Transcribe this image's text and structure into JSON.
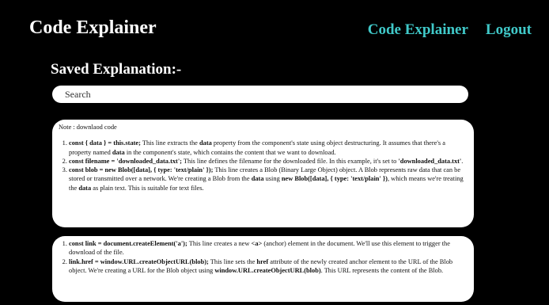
{
  "header": {
    "brand": "Code Explainer",
    "nav": {
      "explainer": "Code Explainer",
      "logout": "Logout"
    }
  },
  "main": {
    "section_title": "Saved Explanation:-",
    "search": {
      "placeholder": "Search",
      "value": ""
    },
    "cards": [
      {
        "note": "Note : downlaod code",
        "items": [
          [
            {
              "t": "const { data } = this.state;",
              "b": true
            },
            {
              "t": " This line extracts the ",
              "b": false
            },
            {
              "t": "data",
              "b": true
            },
            {
              "t": " property from the component's state using object destructuring. It assumes that there's a property named ",
              "b": false
            },
            {
              "t": "data",
              "b": true
            },
            {
              "t": " in the component's state, which contains the content that we want to download.",
              "b": false
            }
          ],
          [
            {
              "t": "const filename = 'downloaded_data.txt';",
              "b": true
            },
            {
              "t": " This line defines the filename for the downloaded file. In this example, it's set to ",
              "b": false
            },
            {
              "t": "'downloaded_data.txt'",
              "b": true
            },
            {
              "t": ".",
              "b": false
            }
          ],
          [
            {
              "t": "const blob = new Blob([data], { type: 'text/plain' });",
              "b": true
            },
            {
              "t": " This line creates a Blob (Binary Large Object) object. A Blob represents raw data that can be stored or transmitted over a network. We're creating a Blob from the ",
              "b": false
            },
            {
              "t": "data",
              "b": true
            },
            {
              "t": " using ",
              "b": false
            },
            {
              "t": "new Blob([data], { type: 'text/plain' })",
              "b": true
            },
            {
              "t": ", which means we're treating the ",
              "b": false
            },
            {
              "t": "data",
              "b": true
            },
            {
              "t": " as plain text. This is suitable for text files.",
              "b": false
            }
          ]
        ]
      },
      {
        "note": "",
        "items": [
          [
            {
              "t": "const link = document.createElement('a');",
              "b": true
            },
            {
              "t": " This line creates a new ",
              "b": false
            },
            {
              "t": "<a>",
              "b": true
            },
            {
              "t": " (anchor) element in the document. We'll use this element to trigger the download of the file.",
              "b": false
            }
          ],
          [
            {
              "t": "link.href = window.URL.createObjectURL(blob);",
              "b": true
            },
            {
              "t": " This line sets the ",
              "b": false
            },
            {
              "t": "href",
              "b": true
            },
            {
              "t": " attribute of the newly created anchor element to the URL of the Blob object. We're creating a URL for the Blob object using ",
              "b": false
            },
            {
              "t": "window.URL.createObjectURL(blob)",
              "b": true
            },
            {
              "t": ". This URL represents the content of the Blob.",
              "b": false
            }
          ]
        ]
      }
    ]
  }
}
